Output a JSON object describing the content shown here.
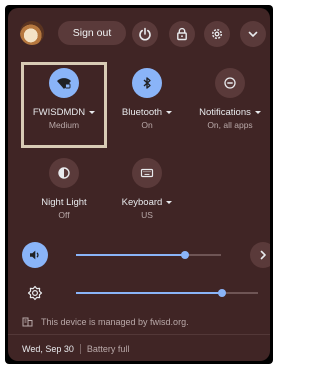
{
  "header": {
    "sign_out_label": "Sign out",
    "buttons": [
      {
        "icon": "power-icon"
      },
      {
        "icon": "lock-icon"
      },
      {
        "icon": "gear-icon"
      },
      {
        "icon": "chevron-down-icon"
      }
    ]
  },
  "pods": [
    {
      "label": "FWISDMDN",
      "sub": "Medium",
      "icon": "wifi-icon",
      "active": true,
      "has_menu": true
    },
    {
      "label": "Bluetooth",
      "sub": "On",
      "icon": "bluetooth-icon",
      "active": true,
      "has_menu": true
    },
    {
      "label": "Notifications",
      "sub": "On, all apps",
      "icon": "notifications-icon",
      "active": false,
      "has_menu": true
    },
    {
      "label": "Night Light",
      "sub": "Off",
      "icon": "night-light-icon",
      "active": false,
      "has_menu": false
    },
    {
      "label": "Keyboard",
      "sub": "US",
      "icon": "keyboard-icon",
      "active": false,
      "has_menu": true
    }
  ],
  "sliders": {
    "volume": {
      "icon": "volume-icon",
      "level": 0.75
    },
    "brightness": {
      "icon": "brightness-icon",
      "level": 0.8
    }
  },
  "managed_text": "This device is managed by fwisd.org.",
  "footer": {
    "date": "Wed, Sep 30",
    "battery": "Battery full"
  },
  "colors": {
    "accent": "#8ab4f8",
    "panel": "#402525",
    "button": "#5a3a3a"
  }
}
